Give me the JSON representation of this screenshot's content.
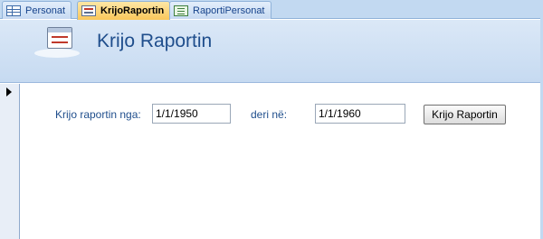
{
  "tabs": [
    {
      "label": "Personat",
      "icon": "table-icon"
    },
    {
      "label": "KrijoRaportin",
      "icon": "form-icon",
      "active": true
    },
    {
      "label": "RaportiPersonat",
      "icon": "report-icon"
    }
  ],
  "header": {
    "title": "Krijo Raportin",
    "icon": "form-icon"
  },
  "form": {
    "from_label": "Krijo raportin nga:",
    "from_value": "1/1/1950",
    "to_label": "deri në:",
    "to_value": "1/1/1960",
    "button_label": "Krijo Raportin"
  },
  "colors": {
    "accent": "#1f4e8c",
    "header_bg": "#c6daf1",
    "active_tab": "#f9c75a"
  }
}
